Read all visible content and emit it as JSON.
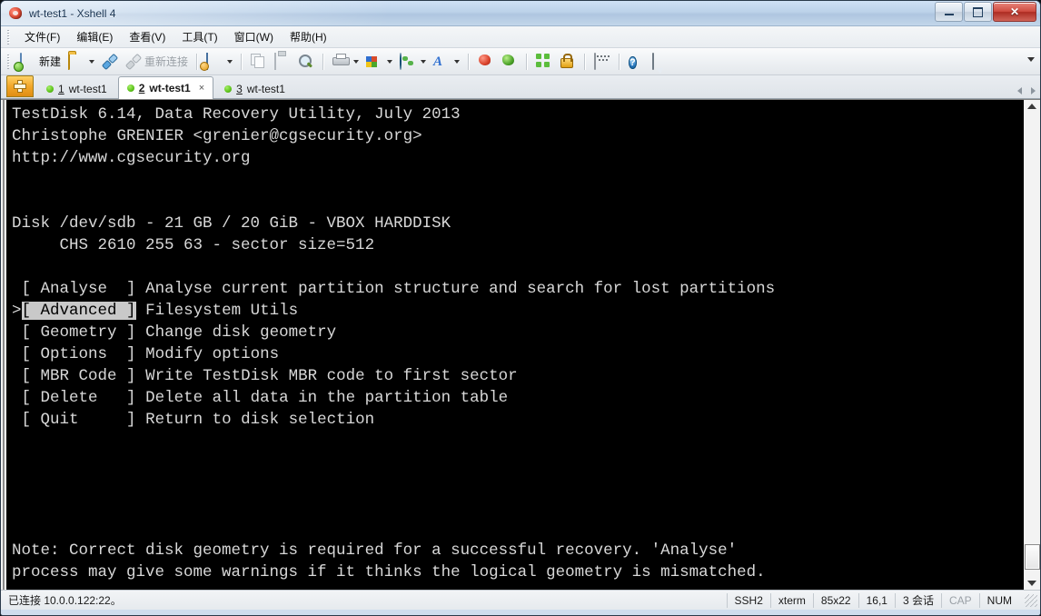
{
  "window": {
    "title": "wt-test1 - Xshell 4",
    "app_icon": "xshell-icon",
    "controls": {
      "minimize": "minimize-button",
      "maximize": "restore-button",
      "close_label": "✕"
    }
  },
  "menubar": {
    "items": [
      {
        "label": "文件(F)",
        "name": "menu-file"
      },
      {
        "label": "编辑(E)",
        "name": "menu-edit"
      },
      {
        "label": "查看(V)",
        "name": "menu-view"
      },
      {
        "label": "工具(T)",
        "name": "menu-tools"
      },
      {
        "label": "窗口(W)",
        "name": "menu-window"
      },
      {
        "label": "帮助(H)",
        "name": "menu-help"
      }
    ]
  },
  "toolbar": {
    "new_label": "新建",
    "reconnect_label": "重新连接",
    "overflow": "toolbar-overflow-chevron"
  },
  "tabs": {
    "newtab_tooltip": "+",
    "items": [
      {
        "number": "1",
        "title": "wt-test1",
        "active": false
      },
      {
        "number": "2",
        "title": "wt-test1",
        "active": true
      },
      {
        "number": "3",
        "title": "wt-test1",
        "active": false
      }
    ],
    "close_glyph": "×"
  },
  "terminal": {
    "colors": {
      "background": "#000000",
      "foreground": "#d8d8d8",
      "highlight_bg": "#c9c9c9",
      "highlight_fg": "#000000"
    },
    "lines": {
      "l1": "TestDisk 6.14, Data Recovery Utility, July 2013",
      "l2": "Christophe GRENIER <grenier@cgsecurity.org>",
      "l3": "http://www.cgsecurity.org",
      "l4": "",
      "l5": "",
      "l6": "Disk /dev/sdb - 21 GB / 20 GiB - VBOX HARDDISK",
      "l7": "     CHS 2610 255 63 - sector size=512",
      "l8": ""
    },
    "menu": {
      "selector": ">",
      "selected_index": 1,
      "entries": [
        {
          "bracket": "[ Analyse  ]",
          "description": "Analyse current partition structure and search for lost partitions"
        },
        {
          "bracket": "[ Advanced ]",
          "description": "Filesystem Utils"
        },
        {
          "bracket": "[ Geometry ]",
          "description": "Change disk geometry"
        },
        {
          "bracket": "[ Options  ]",
          "description": "Modify options"
        },
        {
          "bracket": "[ MBR Code ]",
          "description": "Write TestDisk MBR code to first sector"
        },
        {
          "bracket": "[ Delete   ]",
          "description": "Delete all data in the partition table"
        },
        {
          "bracket": "[ Quit     ]",
          "description": "Return to disk selection"
        }
      ]
    },
    "note": {
      "line1": "Note: Correct disk geometry is required for a successful recovery. 'Analyse'",
      "line2": "process may give some warnings if it thinks the logical geometry is mismatched."
    }
  },
  "statusbar": {
    "connection": "已连接 10.0.0.122:22。",
    "protocol": "SSH2",
    "term_type": "xterm",
    "size": "85x22",
    "cursor": "16,1",
    "sessions": "3 会话",
    "caps": "CAP",
    "num": "NUM"
  }
}
